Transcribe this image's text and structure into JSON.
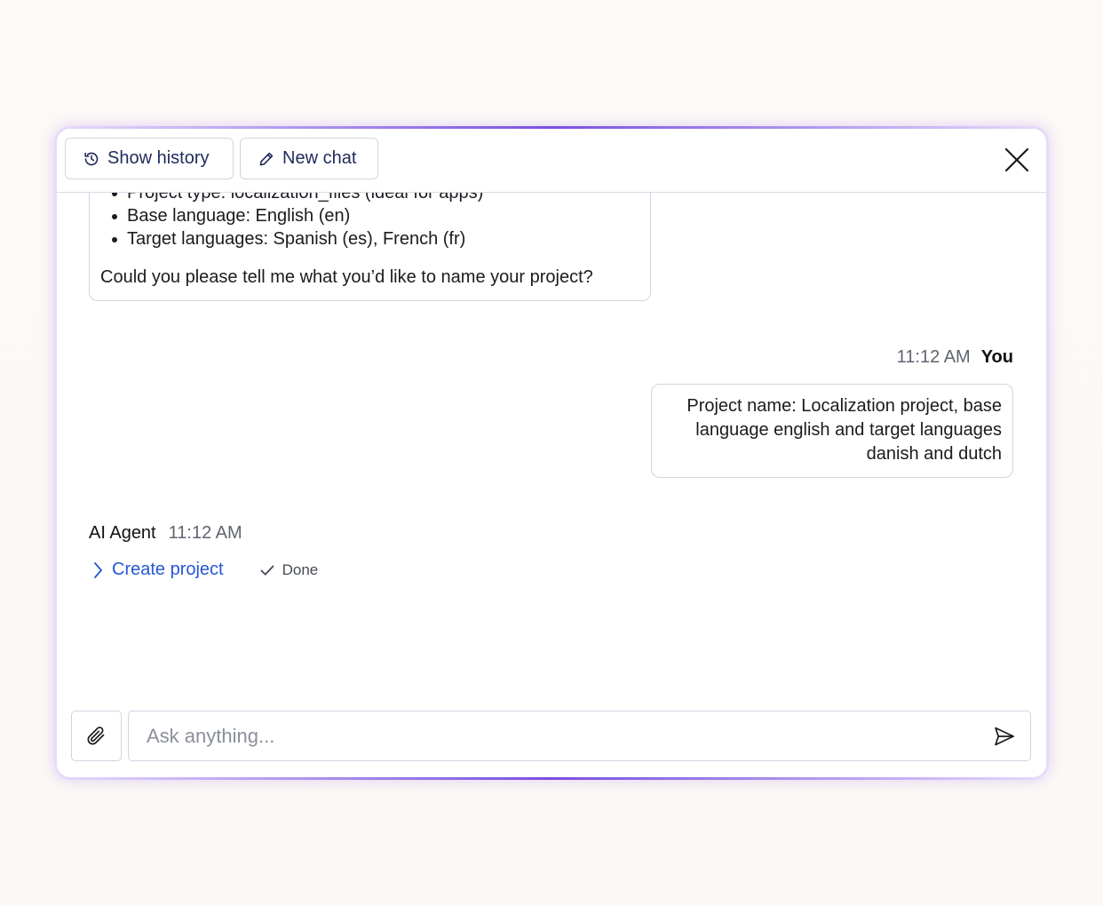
{
  "header": {
    "show_history_label": "Show history",
    "new_chat_label": "New chat"
  },
  "messages": {
    "agent_previous": {
      "items": [
        "Project type: localization_files (ideal for apps)",
        "Base language: English (en)",
        "Target languages: Spanish (es), French (fr)"
      ],
      "question": "Could you please tell me what you’d like to name your project?"
    },
    "user": {
      "time": "11:12 AM",
      "author": "You",
      "lines": [
        "Project name: Localization project, base",
        "language english and target languages",
        "danish and dutch"
      ]
    },
    "agent_latest": {
      "author": "AI Agent",
      "time": "11:12 AM",
      "tool_call": {
        "label": "Create project",
        "status": "Done"
      }
    }
  },
  "composer": {
    "placeholder": "Ask anything..."
  },
  "icons": {
    "history": "history-icon",
    "new_chat": "pencil-icon",
    "close": "close-icon",
    "expand": "chevron-right-icon",
    "status": "check-icon",
    "attach": "paperclip-icon",
    "send": "send-icon"
  },
  "colors": {
    "accent_border": "#7a4fe0",
    "link": "#2456d6",
    "button_text": "#1f2a5a",
    "border": "#cfd5e0"
  }
}
